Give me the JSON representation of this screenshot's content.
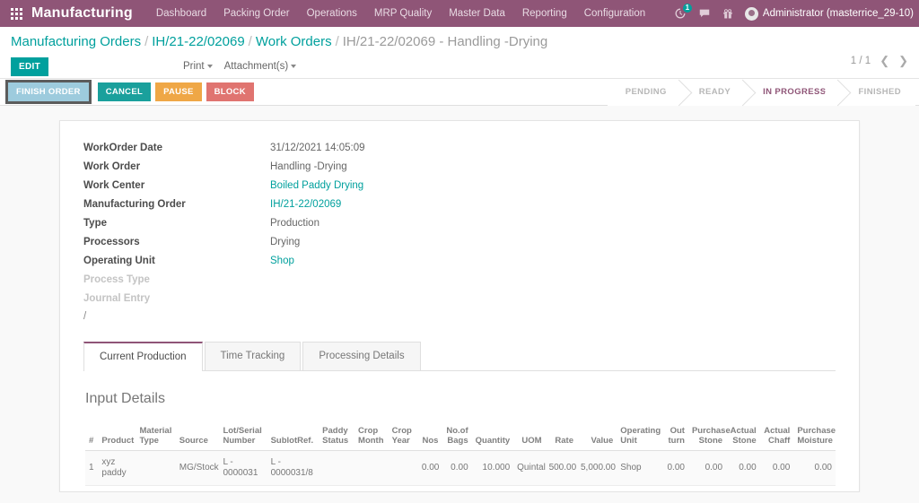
{
  "topbar": {
    "app_title": "Manufacturing",
    "apps_icon": "apps-grid-icon",
    "menus": [
      "Dashboard",
      "Packing Order",
      "Operations",
      "MRP Quality",
      "Master Data",
      "Reporting",
      "Configuration"
    ],
    "activity_icon": "clock-activity-icon",
    "activity_badge": "1",
    "messages_icon": "chat-bubble-icon",
    "gift_icon": "gift-icon",
    "avatar_icon": "avatar-icon",
    "user_label": "Administrator (masterrice_29-10)",
    "brand_color": "#8f5577",
    "accent_color": "#00a09d"
  },
  "controlpanel": {
    "breadcrumb": [
      {
        "label": "Manufacturing Orders",
        "link": true
      },
      {
        "label": "IH/21-22/02069",
        "link": true
      },
      {
        "label": "Work Orders",
        "link": true
      },
      {
        "label": "IH/21-22/02069 - Handling -Drying",
        "link": false
      }
    ],
    "edit_label": "EDIT",
    "print_label": "Print",
    "attachments_label": "Attachment(s)",
    "pager_text": "1 / 1",
    "prev_icon": "chevron-left-icon",
    "next_icon": "chevron-right-icon"
  },
  "actions": {
    "finish_order": "FINISH ORDER",
    "cancel": "CANCEL",
    "pause": "PAUSE",
    "block": "BLOCK"
  },
  "statusbar": {
    "stages": [
      "PENDING",
      "READY",
      "IN PROGRESS",
      "FINISHED"
    ],
    "active": "IN PROGRESS"
  },
  "form": {
    "fields": [
      {
        "label": "WorkOrder Date",
        "value": "31/12/2021 14:05:09",
        "link": false,
        "muted": false
      },
      {
        "label": "Work Order",
        "value": "Handling -Drying",
        "link": false,
        "muted": false
      },
      {
        "label": "Work Center",
        "value": "Boiled Paddy Drying",
        "link": true,
        "muted": false
      },
      {
        "label": "Manufacturing Order",
        "value": "IH/21-22/02069",
        "link": true,
        "muted": false
      },
      {
        "label": "Type",
        "value": "Production",
        "link": false,
        "muted": false
      },
      {
        "label": "Processors",
        "value": "Drying",
        "link": false,
        "muted": false
      },
      {
        "label": "Operating Unit",
        "value": "Shop",
        "link": true,
        "muted": false
      },
      {
        "label": "Process Type",
        "value": "",
        "link": false,
        "muted": true
      },
      {
        "label": "Journal Entry",
        "value": "",
        "link": false,
        "muted": true
      }
    ],
    "trailing_slash": "/"
  },
  "tabs": [
    {
      "label": "Current Production",
      "active": true
    },
    {
      "label": "Time Tracking",
      "active": false
    },
    {
      "label": "Processing Details",
      "active": false
    }
  ],
  "input_details": {
    "title": "Input Details",
    "columns": [
      "#",
      "Product",
      "Material Type",
      "Source",
      "Lot/Serial Number",
      "SublotRef.",
      "Paddy Status",
      "Crop Month",
      "Crop Year",
      "Nos",
      "No.of Bags",
      "Quantity",
      "UOM",
      "Rate",
      "Value",
      "Operating Unit",
      "Out turn",
      "Purchase Stone",
      "Actual Stone",
      "Actual Chaff",
      "Purchase Moisture"
    ],
    "rows": [
      {
        "index": "1",
        "product": "xyz paddy",
        "material_type": "",
        "source": "MG/Stock",
        "lot_serial": "L - 0000031",
        "sublot_ref": "L - 0000031/8",
        "paddy_status": "",
        "crop_month": "",
        "crop_year": "",
        "nos": "0.00",
        "no_of_bags": "0.00",
        "quantity": "10.000",
        "uom": "Quintal",
        "rate": "500.00",
        "value": "5,000.00",
        "operating_unit": "Shop",
        "out_turn": "0.00",
        "purchase_stone": "0.00",
        "actual_stone": "0.00",
        "actual_chaff": "0.00",
        "purchase_moisture": "0.00"
      }
    ]
  }
}
